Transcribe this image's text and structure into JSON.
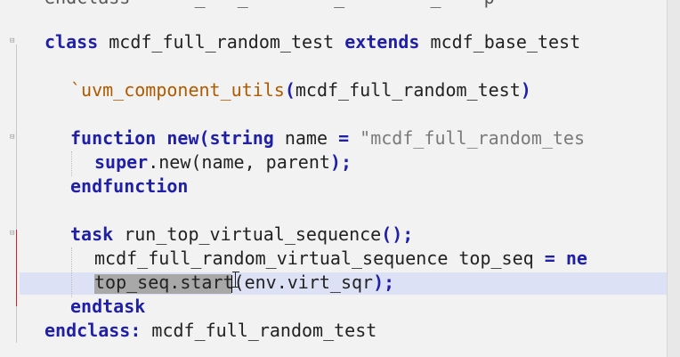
{
  "code": {
    "top_partial": "endclass      _   _        _        _    p",
    "class_kw": "class",
    "class_name": "mcdf_full_random_test",
    "extends_kw": "extends",
    "base_class": "mcdf_base_test",
    "macro": "`uvm_component_utils",
    "macro_paren_open": "(",
    "macro_arg": "mcdf_full_random_test",
    "macro_paren_close": ")",
    "function_kw": "function",
    "new_kw": "new",
    "func_paren": "(",
    "string_kw": "string",
    "name_param": "name",
    "equals": "=",
    "default_str": "\"mcdf_full_random_tes",
    "super_kw": "super",
    "super_call": ".new(name, parent",
    "super_end": ");",
    "endfunction_kw": "endfunction",
    "task_kw": "task",
    "task_name": "run_top_virtual_sequence",
    "task_parens": "();",
    "seq_decl": "mcdf_full_random_virtual_sequence top_seq",
    "seq_eq": "=",
    "seq_new": "ne",
    "sel_text": "top_seq.sta",
    "after_sel": "rt(env.virt_sqr",
    "start_end": ");",
    "endtask_kw": "endtask",
    "endclass_kw": "endclass",
    "endclass_colon": ":",
    "endclass_name": "mcdf_full_random_test"
  }
}
